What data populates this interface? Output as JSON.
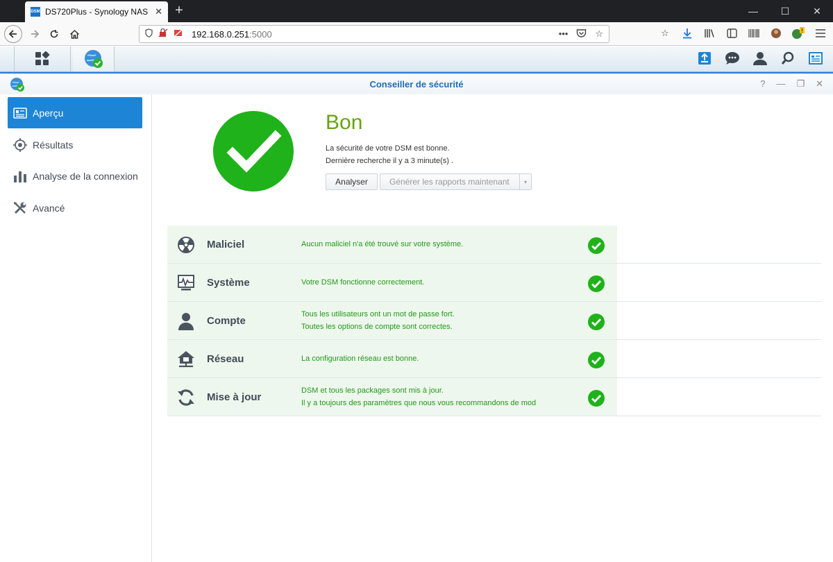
{
  "browser": {
    "tab_title": "DS720Plus - Synology NAS",
    "tab_favicon": "DSM",
    "url_host": "192.168.0.251",
    "url_port": ":5000"
  },
  "window": {
    "title": "Conseiller de sécurité"
  },
  "sidebar": {
    "items": [
      {
        "label": "Aperçu",
        "icon": "overview-icon"
      },
      {
        "label": "Résultats",
        "icon": "target-icon"
      },
      {
        "label": "Analyse de la connexion",
        "icon": "bar-chart-icon"
      },
      {
        "label": "Avancé",
        "icon": "tools-icon"
      }
    ]
  },
  "status": {
    "title": "Bon",
    "line1": "La sécurité de votre DSM est bonne.",
    "line2": "Dernière recherche il y a 3 minute(s) .",
    "analyse_label": "Analyser",
    "report_label": "Générer les rapports maintenant"
  },
  "checks": [
    {
      "label": "Maliciel",
      "icon": "radiation-icon",
      "msg1": "Aucun maliciel n'a été trouvé sur votre système.",
      "msg2": ""
    },
    {
      "label": "Système",
      "icon": "monitor-pulse-icon",
      "msg1": "Votre DSM fonctionne correctement.",
      "msg2": ""
    },
    {
      "label": "Compte",
      "icon": "user-icon",
      "msg1": "Tous les utilisateurs ont un mot de passe fort.",
      "msg2": "Toutes les options de compte sont correctes."
    },
    {
      "label": "Réseau",
      "icon": "network-home-icon",
      "msg1": "La configuration réseau est bonne.",
      "msg2": ""
    },
    {
      "label": "Mise à jour",
      "icon": "refresh-icon",
      "msg1": "DSM et tous les packages sont mis à jour.",
      "msg2": "Il y a toujours des paramètres que nous vous recommandons de mod"
    }
  ],
  "colors": {
    "accent": "#1d84d6",
    "good_green": "#1fb21a",
    "title_green": "#67a40e",
    "msg_green": "#1f9a16"
  }
}
